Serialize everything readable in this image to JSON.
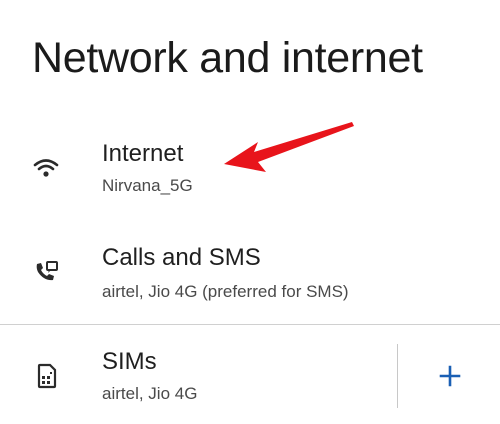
{
  "header": {
    "title": "Network and internet"
  },
  "items": [
    {
      "label": "Internet",
      "subtitle": "Nirvana_5G",
      "icon": "wifi-icon"
    },
    {
      "label": "Calls and SMS",
      "subtitle": "airtel, Jio 4G (preferred for SMS)",
      "icon": "calls-sms-icon"
    },
    {
      "label": "SIMs",
      "subtitle": "airtel, Jio 4G",
      "icon": "sim-card-icon"
    }
  ],
  "sims_action": {
    "icon": "plus-icon"
  },
  "annotation": {
    "icon": "red-arrow-icon"
  },
  "colors": {
    "accent": "#1a5fb4",
    "arrow": "#e8141b",
    "text_primary": "#1f1f1f",
    "text_secondary": "#4a4a4a",
    "divider": "#d0d0d0"
  }
}
